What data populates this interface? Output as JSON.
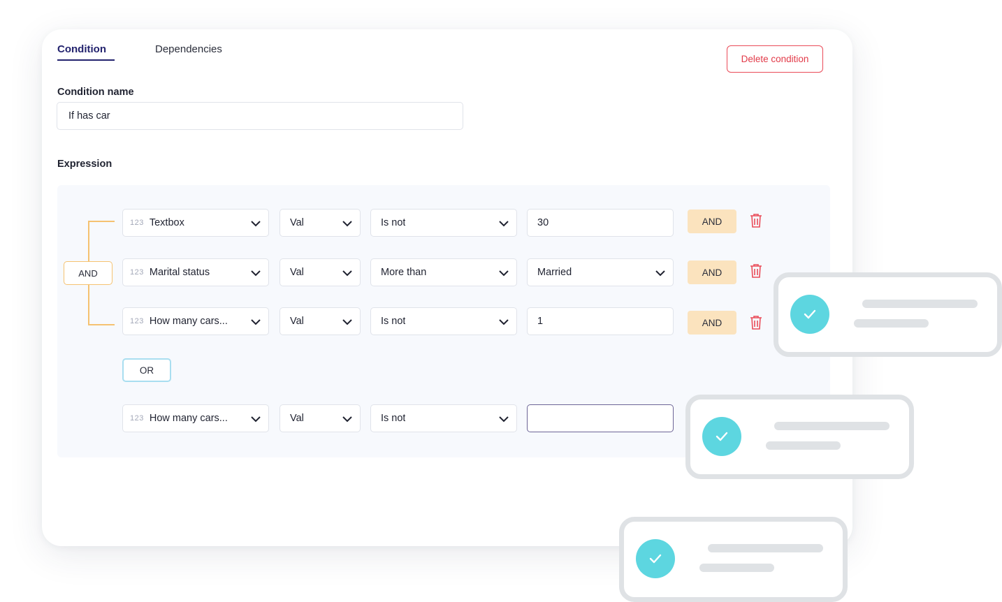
{
  "tabs": [
    {
      "label": "Condition",
      "active": true
    },
    {
      "label": "Dependencies",
      "active": false
    }
  ],
  "delete_label": "Delete condition",
  "condition_name": {
    "label": "Condition name",
    "value": "If has car"
  },
  "expression": {
    "label": "Expression",
    "group_operator": "AND",
    "rows": [
      {
        "type_icon": "123",
        "field": "Textbox",
        "val": "Val",
        "operator": "Is not",
        "value": "30",
        "value_is_select": false,
        "chip": "AND"
      },
      {
        "type_icon": "123",
        "field": "Marital status",
        "val": "Val",
        "operator": "More than",
        "value": "Married",
        "value_is_select": true,
        "chip": "AND"
      },
      {
        "type_icon": "123",
        "field": "How many cars...",
        "val": "Val",
        "operator": "Is not",
        "value": "1",
        "value_is_select": false,
        "chip": "AND"
      }
    ],
    "or_label": "OR",
    "or_row": {
      "type_icon": "123",
      "field": "How many cars...",
      "val": "Val",
      "operator": "Is not",
      "value": ""
    }
  },
  "colors": {
    "accent": "#23236e",
    "danger": "#e23a48",
    "and_chip": "#fbe3be",
    "bracket": "#f5c271",
    "check": "#5dd6e0"
  }
}
